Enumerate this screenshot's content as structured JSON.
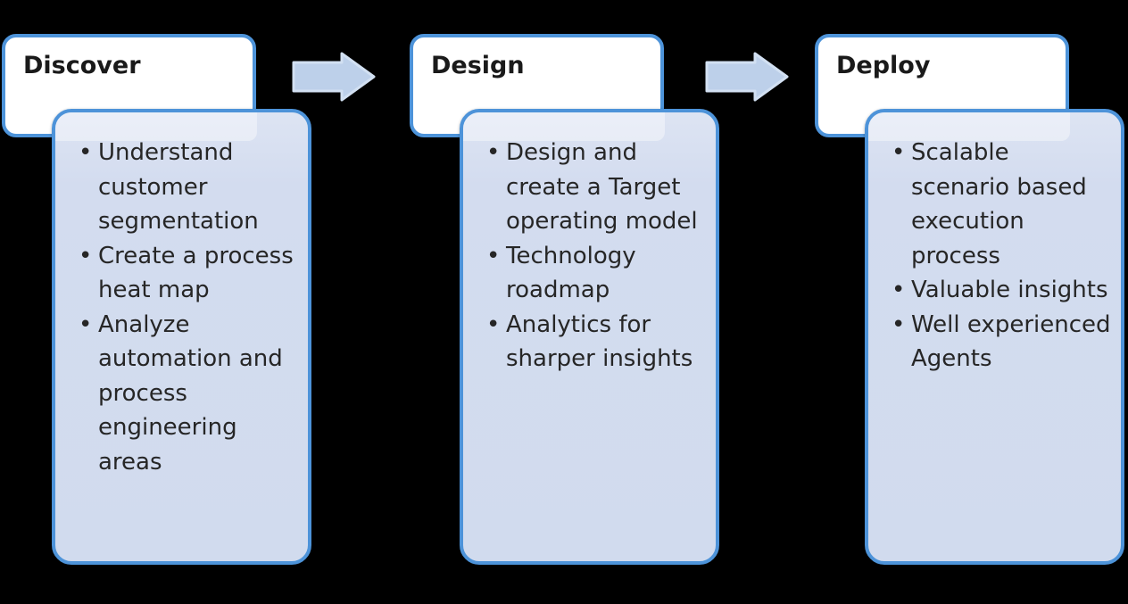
{
  "background_color": "#000000",
  "theme": {
    "card_border": "#4d93d9",
    "header_fill": "#ffffff",
    "body_fill": "#d3dcef",
    "arrow_fill": "#bdd0ea",
    "arrow_border": "#cfddf0",
    "text_color": "#262626"
  },
  "diagram": {
    "type": "process-flow",
    "direction": "left-to-right",
    "stage_count": 3,
    "connector_count": 2,
    "connector_icon": "right-arrow-icon",
    "bullet_glyph": "•",
    "stages": [
      {
        "title": "Discover",
        "bullets": [
          "Understand customer segmentation",
          "Create a process heat map",
          "Analyze automation and process engineering areas"
        ]
      },
      {
        "title": "Design",
        "bullets": [
          "Design and create a Target operating model",
          "Technology roadmap",
          "Analytics for sharper insights"
        ]
      },
      {
        "title": "Deploy",
        "bullets": [
          "Scalable scenario based execution process",
          "Valuable insights",
          "Well experienced Agents"
        ]
      }
    ]
  }
}
